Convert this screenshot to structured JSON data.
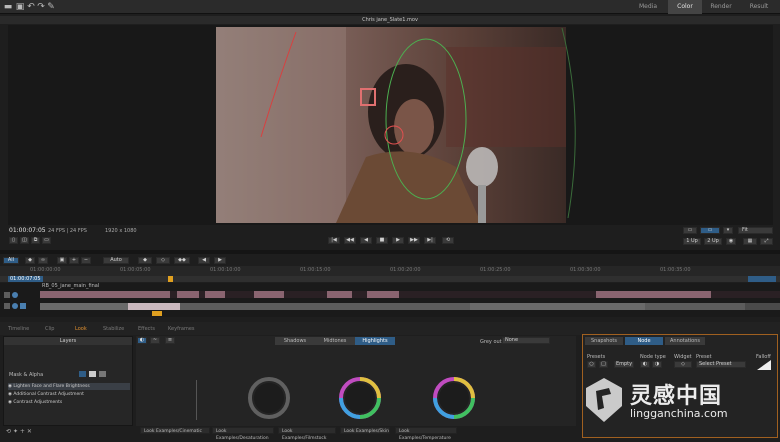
{
  "top_tabs": [
    "Media",
    "Color",
    "Render",
    "Result"
  ],
  "active_tab": "Color",
  "file_title": "Chris jane_Slate1.mov",
  "viewer": {
    "timecode": "01:00:07:05",
    "fps": "24 FPS | 24 FPS",
    "resolution": "1920 x 1080",
    "fit_label": "Fit",
    "views": [
      "1 Up",
      "2 Up"
    ]
  },
  "timeline": {
    "mode_label": "All",
    "auto_label": "Auto",
    "track_name": "RB_05_jane_main_final",
    "ruler_labels": [
      "01:00:00:00",
      "01:00:05:00",
      "01:00:10:00",
      "01:00:15:00",
      "01:00:20:00",
      "01:00:25:00",
      "01:00:30:00",
      "01:00:35:00",
      "01:00:40:00"
    ],
    "current_marker": "01:00:07:05"
  },
  "panel_tabs": [
    "Timeline",
    "Clip",
    "Look",
    "Stabilize",
    "Effects",
    "Keyframes"
  ],
  "active_panel_tab": "Look",
  "layers": {
    "header": "Layers",
    "mask_label": "Mask & Alpha",
    "items": [
      {
        "name": "Lighten Face and Flare Brightness",
        "checked": true
      },
      {
        "name": "Additional Contrast Adjustment",
        "checked": true
      },
      {
        "name": "Contrast Adjustments",
        "checked": true
      }
    ]
  },
  "range_tabs": [
    "Shadows",
    "Midtones",
    "Highlights"
  ],
  "preset_tabs_extra": {
    "grey_label": "Grey out",
    "grey_value": "None"
  },
  "looks": [
    "Look Examples/Cinematic",
    "Look Examples/Desaturation",
    "Look Examples/Filmstock",
    "Look Examples/Skin",
    "Look Examples/Temperature"
  ],
  "right_panel": {
    "tabs": [
      "Snapshots",
      "Node",
      "Annotations"
    ],
    "active": "Node",
    "labels": {
      "presets": "Presets",
      "node_type": "Node type",
      "widget": "Widget",
      "preset": "Preset",
      "falloff": "Falloff"
    },
    "buttons": {
      "empty": "Empty",
      "select": "Select Preset"
    }
  },
  "watermark": {
    "cn": "灵感中国",
    "url": "lingganchina.com"
  },
  "colors": {
    "accent": "#2f5d87",
    "clip_red": "#8a6470",
    "clip_pink": "#b08a94"
  }
}
